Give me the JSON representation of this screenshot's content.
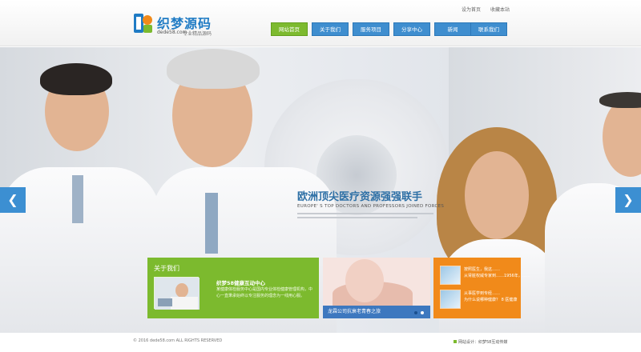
{
  "header": {
    "logo_title": "织梦源码",
    "logo_domain": "dede58.com",
    "logo_slogan": "专业精品源码",
    "top_links": [
      "设为首页",
      "收藏本站"
    ]
  },
  "nav": {
    "items": [
      "网站首页",
      "关于我们",
      "服务项目",
      "分享中心",
      "新闻",
      "联系我们"
    ],
    "active_index": 0,
    "colors": {
      "active": "#7dba2f",
      "normal": "#3f8ecf"
    }
  },
  "banner": {
    "headline": "欧洲顶尖医疗资源强强联手",
    "subline": "EUROPE' S TOP DOCTORS AND PROFESSORS JOINED FORCES",
    "prev_icon": "chevron-left-icon",
    "next_icon": "chevron-right-icon"
  },
  "about_panel": {
    "title": "关于我们",
    "heading": "织梦58健康互动中心",
    "text": "某健康体检服务中心是国内专业体检健康管理机构，中心一直秉承始终以专注服务的理念为一线用心服。",
    "color": "#7cba2e"
  },
  "mid_panel": {
    "caption": "龙霖公司抗衰老青春之旅",
    "bar_color": "#3d78bf"
  },
  "orange_panel": {
    "items": [
      {
        "line1": "按照医生，我这……",
        "line2": "从肾脏权威专家到……1956年，……"
      },
      {
        "line1": "从事医学到专经……",
        "line2": "为什么说哪种健康？ 8 医健康"
      }
    ],
    "color": "#f18a1a"
  },
  "footer": {
    "copyright": "© 2016 dede58.com ALL RIGHTS RESERVED",
    "credit": "网站设计：织梦58互动传媒"
  }
}
